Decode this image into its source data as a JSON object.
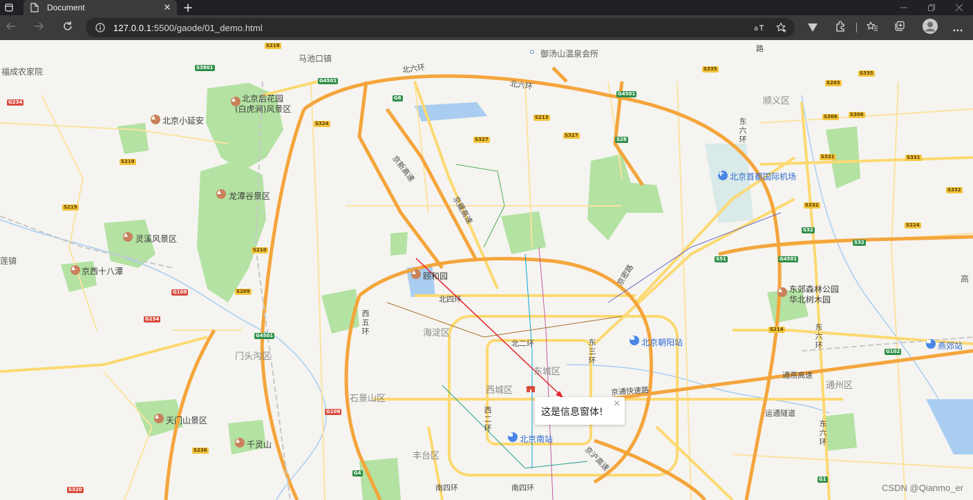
{
  "browser": {
    "tab_title": "Document",
    "tab_close": "✕",
    "new_tab": "+",
    "url_host": "127.0.0.1",
    "url_rest": ":5500/gaode/01_demo.html"
  },
  "map": {
    "labels": {
      "fucheng": "福成农家院",
      "machikou": "马池口镇",
      "yutang": "御汤山温泉会所",
      "shunyi": "顺义区",
      "houhuayuan_1": "北京后花园",
      "houhuayuan_2": "(白虎涧)风景区",
      "xiaoyanan": "北京小延安",
      "airport": "北京首都国际机场",
      "longtan": "龙潭谷景区",
      "lingxi": "灵溪风景区",
      "jingxi": "京西十八潭",
      "yiheyuan": "颐和园",
      "haidian": "海淀区",
      "mentougou": "门头沟区",
      "shijingshan": "石景山区",
      "xicheng": "西城区",
      "dongcheng": "东城区",
      "fengtai": "丰台区",
      "tongzhou": "通州区",
      "chaoyang_station": "北京朝阳站",
      "south_station": "北京南站",
      "yanjiao": "燕郊站",
      "dongjiao_1": "东郊森林公园",
      "dongjiao_2": "华北树木园",
      "tianmen": "天门山景区",
      "qianling": "千灵山",
      "edge_zhen": "莲镇",
      "edge_gao": "高",
      "road_bei6_1": "北六环",
      "road_bei6_2": "北六环",
      "road_bei4": "北四环",
      "road_bei2": "北二环",
      "road_xi5": "西五环",
      "road_xi2": "西二环",
      "road_dong3": "东三环",
      "road_dong6_a": "东六环",
      "road_dong6_b": "东六环",
      "road_dong6_c": "东六环",
      "road_jingxin": "京新高速",
      "road_jingzang": "京藏高速",
      "road_jingmi": "京密路",
      "road_jingtong": "京通快速路",
      "road_tongyan": "通燕高速",
      "road_yuntong": "运通隧道",
      "road_nan4": "南四环",
      "road_nan4b": "南四环",
      "road_jinghu": "京沪高速",
      "road_lu": "路"
    },
    "shields": [
      "S218",
      "S3801",
      "G4501",
      "G6",
      "S335",
      "S335",
      "S203",
      "G234",
      "G4501",
      "S213",
      "S327",
      "S327",
      "S324",
      "S28",
      "S306",
      "S306",
      "S219",
      "S331",
      "S331",
      "S219",
      "S332",
      "S332",
      "S224",
      "S210",
      "S32",
      "S32",
      "S51",
      "G4501",
      "G109",
      "S209",
      "G234",
      "S214",
      "G4501",
      "G102",
      "G108",
      "S236",
      "G4",
      "S320",
      "G1"
    ],
    "info_window": "这是信息窗体!",
    "info_close": "×",
    "watermark": "CSDN @Qianmo_er"
  },
  "icons": [
    "window-icon",
    "tab-page-icon",
    "back-arrow-icon",
    "forward-arrow-icon",
    "refresh-icon",
    "info-icon",
    "read-aloud-icon",
    "add-favorite-icon",
    "extension-v-icon",
    "extensions-icon",
    "favorites-icon",
    "collections-icon",
    "profile-avatar-icon",
    "more-icon"
  ],
  "colors": {
    "highway": "#f4a53b",
    "main_road": "#fcd971",
    "park": "#a7dd97",
    "water": "#a8cdf0",
    "chrome_dark": "#202124",
    "chrome_toolbar": "#3b3b3b"
  }
}
